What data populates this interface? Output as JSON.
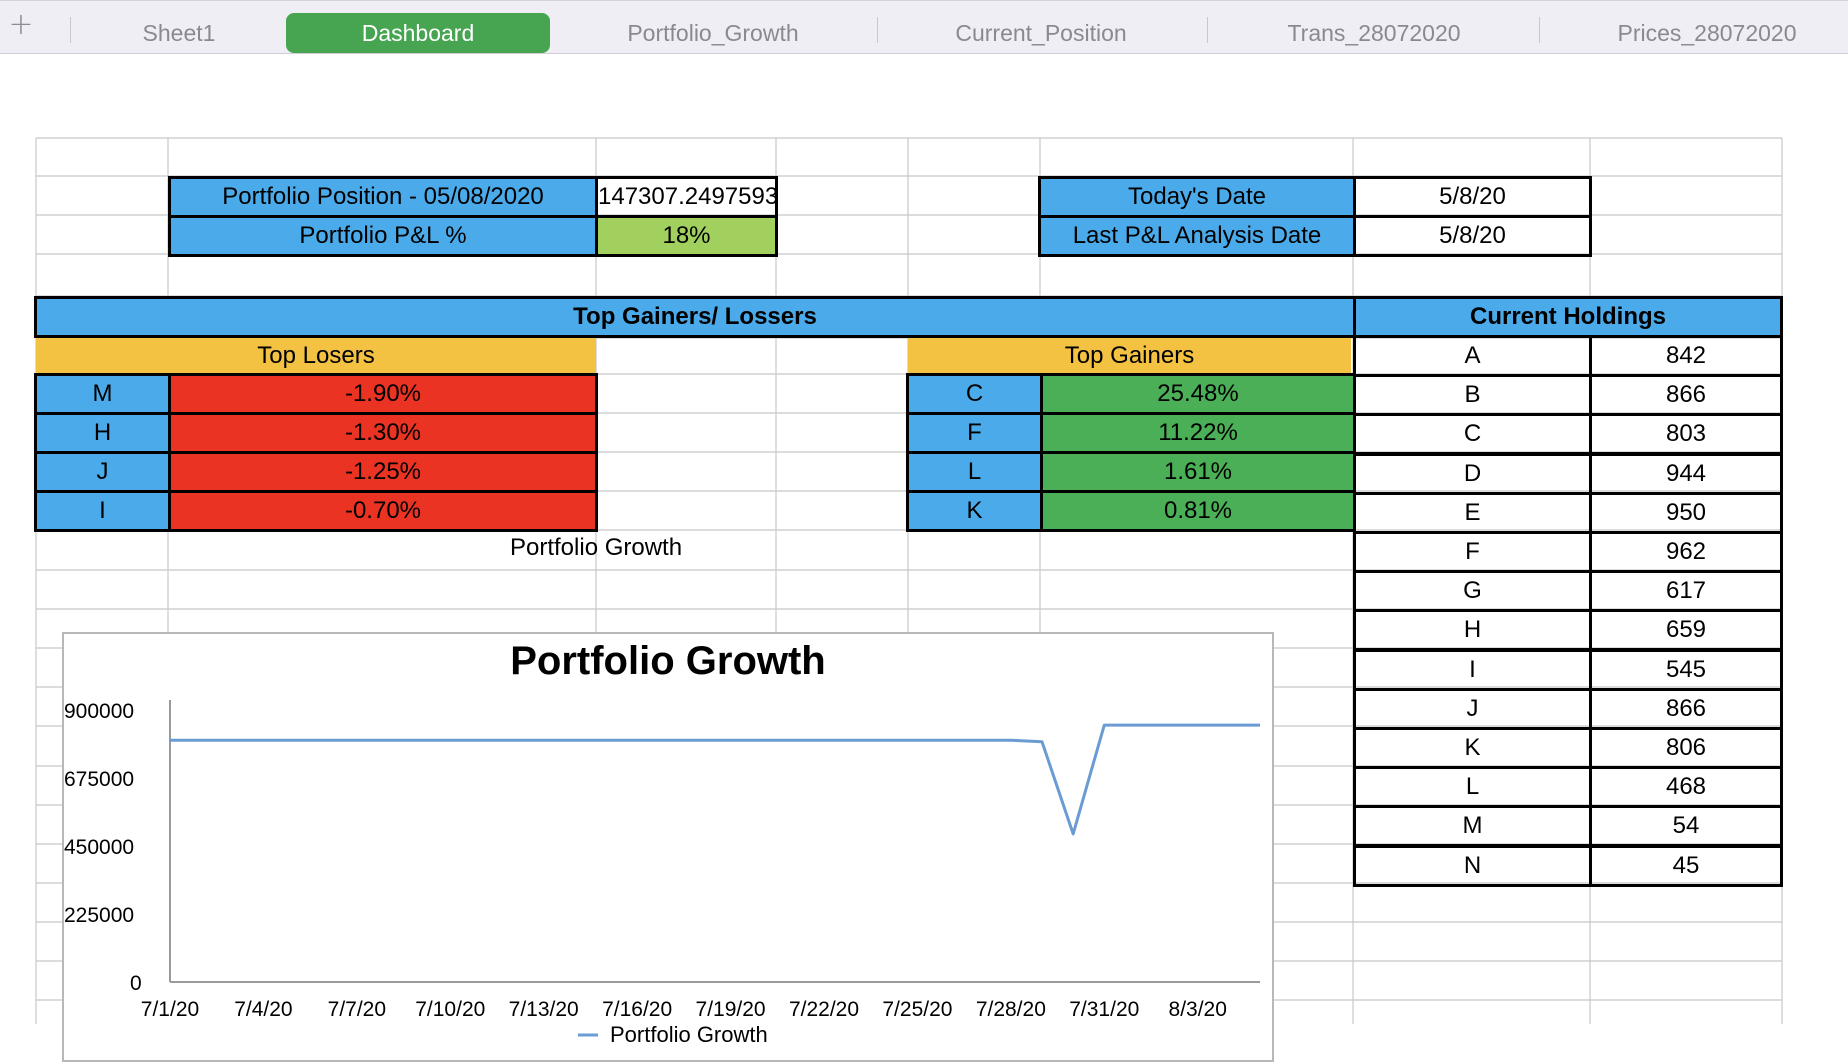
{
  "tabs": {
    "add_symbol": "+",
    "items": [
      {
        "label": "Sheet1",
        "active": false
      },
      {
        "label": "Dashboard",
        "active": true
      },
      {
        "label": "Portfolio_Growth",
        "active": false
      },
      {
        "label": "Current_Position",
        "active": false
      },
      {
        "label": "Trans_28072020",
        "active": false
      },
      {
        "label": "Prices_28072020",
        "active": false
      }
    ]
  },
  "summary": {
    "position_label": "Portfolio Position - 05/08/2020",
    "position_value": "147307.24975935",
    "pl_label": "Portfolio P&L %",
    "pl_value": "18%",
    "today_label": "Today's Date",
    "today_value": "5/8/20",
    "last_label": "Last P&L Analysis Date",
    "last_value": "5/8/20"
  },
  "gainers_losers": {
    "header": "Top Gainers/ Lossers",
    "losers_header": "Top Losers",
    "gainers_header": "Top Gainers",
    "losers": [
      {
        "ticker": "M",
        "change": "-1.90%"
      },
      {
        "ticker": "H",
        "change": "-1.30%"
      },
      {
        "ticker": "J",
        "change": "-1.25%"
      },
      {
        "ticker": "I",
        "change": "-0.70%"
      }
    ],
    "gainers": [
      {
        "ticker": "C",
        "change": "25.48%"
      },
      {
        "ticker": "F",
        "change": "11.22%"
      },
      {
        "ticker": "L",
        "change": "1.61%"
      },
      {
        "ticker": "K",
        "change": "0.81%"
      }
    ]
  },
  "holdings": {
    "header": "Current Holdings",
    "rows": [
      {
        "ticker": "A",
        "qty": "842"
      },
      {
        "ticker": "B",
        "qty": "866"
      },
      {
        "ticker": "C",
        "qty": "803"
      },
      {
        "ticker": "D",
        "qty": "944"
      },
      {
        "ticker": "E",
        "qty": "950"
      },
      {
        "ticker": "F",
        "qty": "962"
      },
      {
        "ticker": "G",
        "qty": "617"
      },
      {
        "ticker": "H",
        "qty": "659"
      },
      {
        "ticker": "I",
        "qty": "545"
      },
      {
        "ticker": "J",
        "qty": "866"
      },
      {
        "ticker": "K",
        "qty": "806"
      },
      {
        "ticker": "L",
        "qty": "468"
      },
      {
        "ticker": "M",
        "qty": "54"
      },
      {
        "ticker": "N",
        "qty": "45"
      }
    ]
  },
  "chart_cell_label": "Portfolio Growth",
  "colors": {
    "blue": "#4aaaea",
    "green_light": "#a1d05f",
    "green": "#4aaf56",
    "red": "#ea3323",
    "gold": "#f3c243",
    "tab_active": "#47a552",
    "series_line": "#6a9bd2"
  },
  "chart_data": {
    "type": "line",
    "title": "Portfolio Growth",
    "xlabel": "",
    "ylabel": "",
    "x_ticks": [
      "7/1/20",
      "7/4/20",
      "7/7/20",
      "7/10/20",
      "7/13/20",
      "7/16/20",
      "7/19/20",
      "7/22/20",
      "7/25/20",
      "7/28/20",
      "7/31/20",
      "8/3/20"
    ],
    "y_ticks": [
      "0",
      "225000",
      "450000",
      "675000",
      "900000"
    ],
    "ylim": [
      0,
      900000
    ],
    "xlim": [
      "2020-07-01",
      "2020-08-05"
    ],
    "grid": false,
    "legend": "bottom",
    "series": [
      {
        "name": "Portfolio Growth",
        "x": [
          "2020-07-01",
          "2020-07-28",
          "2020-07-29",
          "2020-07-30",
          "2020-07-31",
          "2020-08-05"
        ],
        "y": [
          800000,
          800000,
          795000,
          490000,
          850000,
          850000
        ]
      }
    ]
  }
}
